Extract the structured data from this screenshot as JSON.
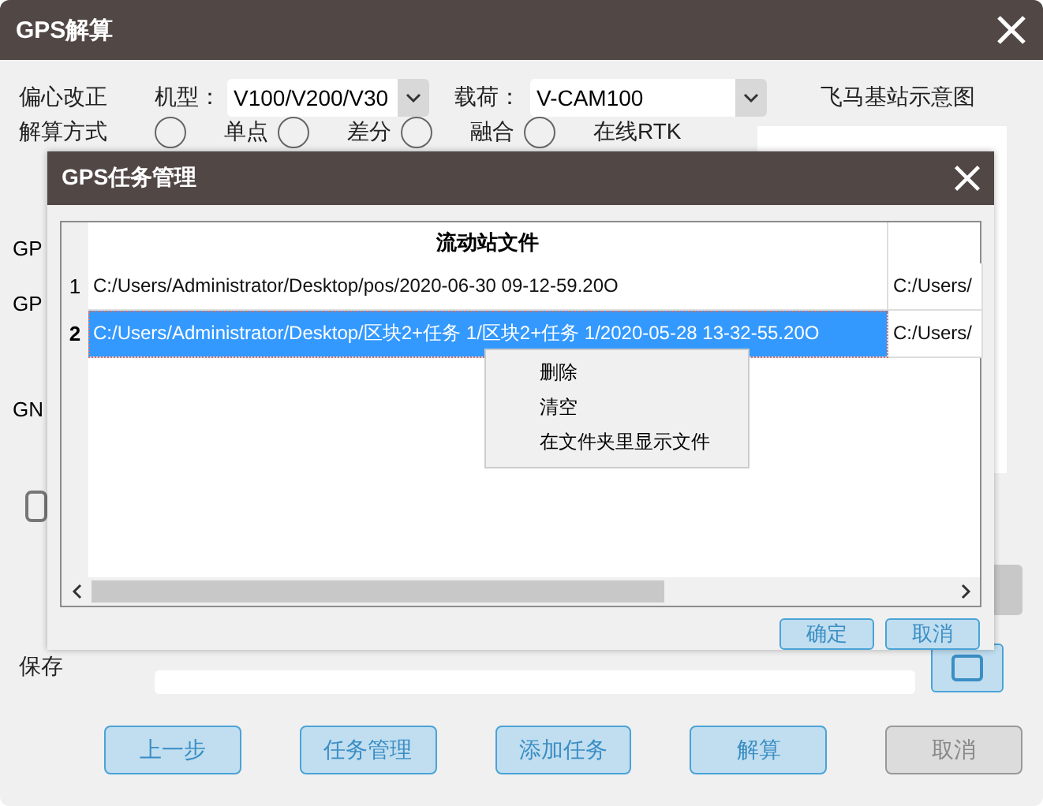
{
  "window": {
    "title": "GPS解算"
  },
  "offset_correction": {
    "label": "偏心改正",
    "model_label": "机型：",
    "model_value": "V100/V200/V30",
    "payload_label": "载荷：",
    "payload_value": "V-CAM100"
  },
  "diagram": {
    "title": "飞马基站示意图"
  },
  "solve_mode": {
    "label": "解算方式",
    "options": [
      {
        "label": "单点",
        "selected": false
      },
      {
        "label": "差分",
        "selected": false
      },
      {
        "label": "融合",
        "selected": false
      },
      {
        "label": "在线RTK",
        "selected": false
      }
    ]
  },
  "partial_labels": [
    "GP",
    "GP",
    "GN"
  ],
  "checkbox": {
    "checked": false
  },
  "save_path": {
    "label": "保存"
  },
  "buttons": [
    {
      "label": "上一步",
      "disabled": false
    },
    {
      "label": "任务管理",
      "disabled": false
    },
    {
      "label": "添加任务",
      "disabled": false
    },
    {
      "label": "解算",
      "disabled": false
    },
    {
      "label": "取消",
      "disabled": true
    }
  ],
  "task_dialog": {
    "title": "GPS任务管理",
    "table": {
      "columns": [
        "流动站文件"
      ],
      "rows": [
        {
          "number": "1",
          "file": "C:/Users/Administrator/Desktop/pos/2020-06-30 09-12-59.20O",
          "column_2": "C:/Users/",
          "selected": false
        },
        {
          "number": "2",
          "file": "C:/Users/Administrator/Desktop/区块2+任务 1/区块2+任务 1/2020-05-28 13-32-55.20O",
          "column_2": "C:/Users/",
          "selected": true
        }
      ]
    },
    "context_menu": [
      "删除",
      "清空",
      "在文件夹里显示文件"
    ],
    "buttons": [
      "确定",
      "取消"
    ]
  }
}
